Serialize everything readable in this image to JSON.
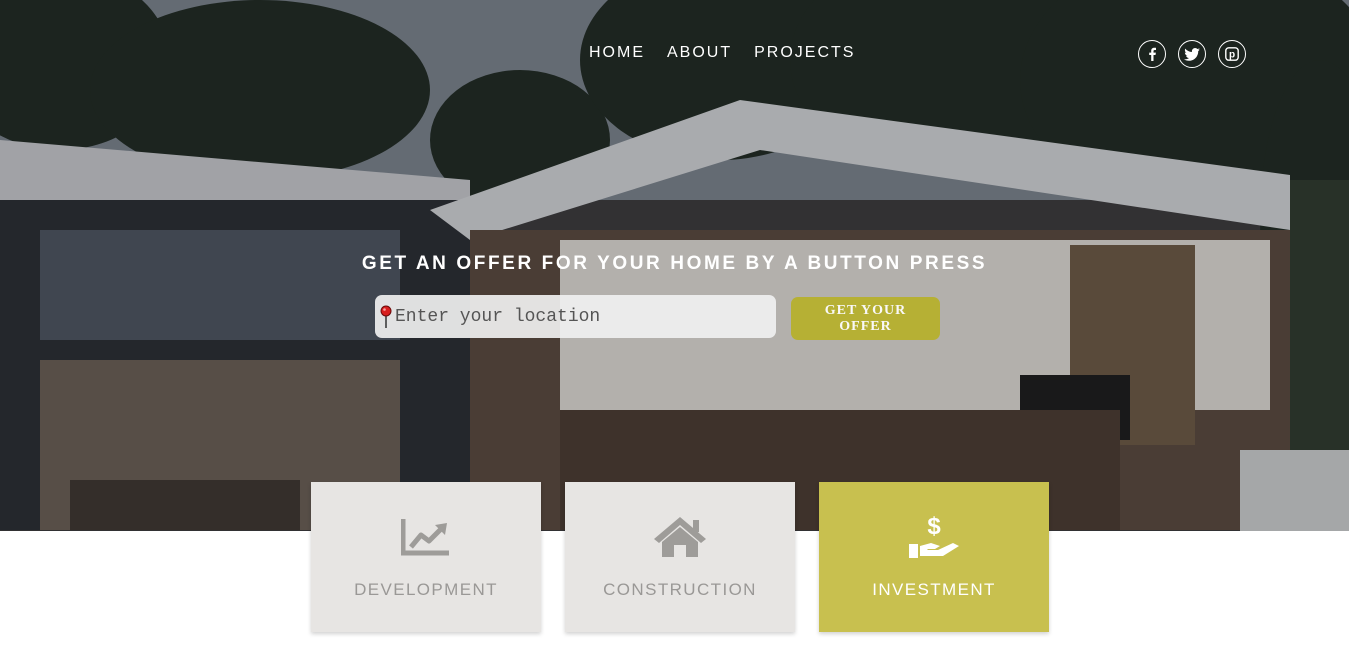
{
  "nav": {
    "items": [
      {
        "label": "HOME"
      },
      {
        "label": "ABOUT"
      },
      {
        "label": "PROJECTS"
      }
    ]
  },
  "social": [
    "facebook-icon",
    "twitter-icon",
    "pinterest-icon"
  ],
  "hero": {
    "headline": "GET AN OFFER FOR YOUR HOME BY A BUTTON PRESS",
    "search_placeholder": "Enter your location",
    "offer_button": "GET YOUR OFFER"
  },
  "cards": [
    {
      "label": "DEVELOPMENT",
      "icon": "chart-line-icon"
    },
    {
      "label": "CONSTRUCTION",
      "icon": "house-icon"
    },
    {
      "label": "INVESTMENT",
      "icon": "hand-dollar-icon",
      "active": true
    }
  ],
  "colors": {
    "accent": "#c8c04f",
    "card_bg": "#e7e5e3",
    "card_text": "#9a9896"
  }
}
